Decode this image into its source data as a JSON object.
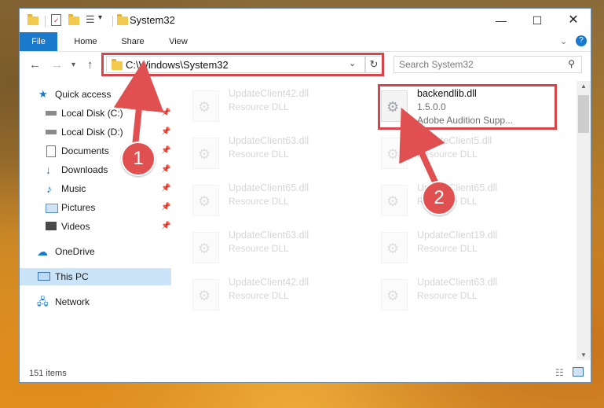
{
  "window": {
    "title": "System32"
  },
  "ribbon": {
    "tabs": [
      "File",
      "Home",
      "Share",
      "View"
    ]
  },
  "address": {
    "path": "C:\\Windows\\System32"
  },
  "search": {
    "placeholder": "Search System32"
  },
  "nav": {
    "items": [
      {
        "label": "Quick access"
      },
      {
        "label": "Local Disk (C:)"
      },
      {
        "label": "Local Disk (D:)"
      },
      {
        "label": "Documents"
      },
      {
        "label": "Downloads"
      },
      {
        "label": "Music"
      },
      {
        "label": "Pictures"
      },
      {
        "label": "Videos"
      },
      {
        "label": "OneDrive"
      },
      {
        "label": "This PC"
      },
      {
        "label": "Network"
      }
    ]
  },
  "files": {
    "col1": [
      {
        "name": "UpdateClient42.dll",
        "type": "Resource DLL"
      },
      {
        "name": "UpdateClient63.dll",
        "type": "Resource DLL"
      },
      {
        "name": "UpdateClient65.dll",
        "type": "Resource DLL"
      },
      {
        "name": "UpdateClient63.dll",
        "type": "Resource DLL"
      },
      {
        "name": "UpdateClient42.dll",
        "type": "Resource DLL"
      }
    ],
    "highlighted": {
      "name": "backendlib.dll",
      "version": "1.5.0.0",
      "description": "Adobe Audition Supp..."
    },
    "col2": [
      {
        "name": "UpdateClient5.dll",
        "type": "Resource DLL"
      },
      {
        "name": "UpdateClient65.dll",
        "type": "Resource DLL"
      },
      {
        "name": "UpdateClient19.dll",
        "type": "Resource DLL"
      },
      {
        "name": "UpdateClient63.dll",
        "type": "Resource DLL"
      }
    ]
  },
  "status": {
    "count": "151 items"
  },
  "callouts": {
    "first": "1",
    "second": "2"
  },
  "colors": {
    "accent": "#1979ca",
    "highlight": "#d9444a",
    "callout": "#e05050"
  }
}
